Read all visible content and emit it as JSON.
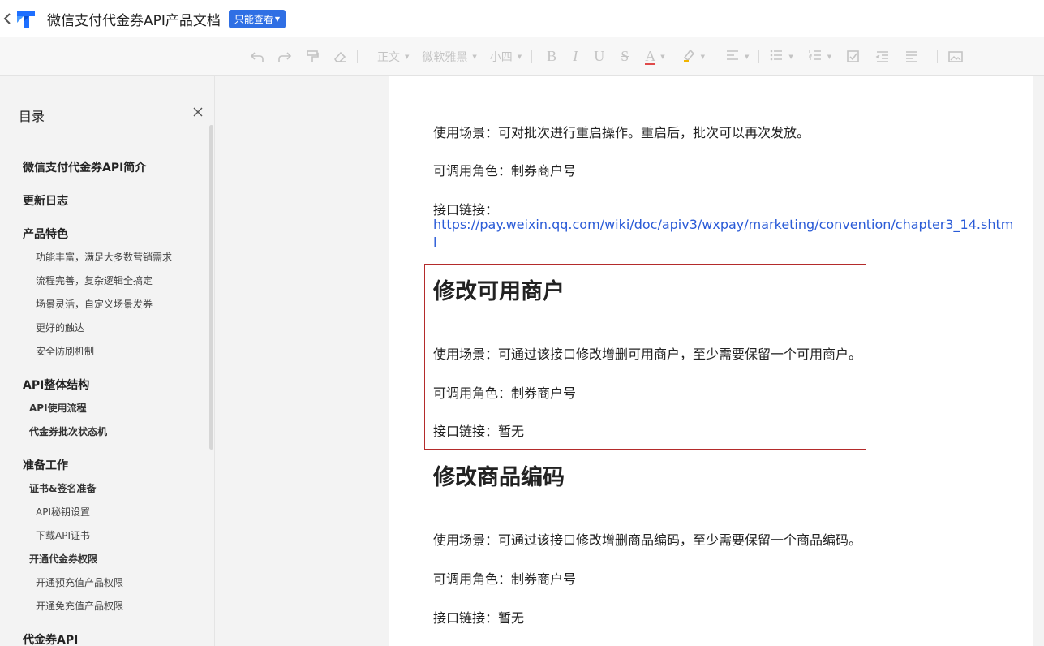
{
  "header": {
    "back_icon": "chevron-left-icon",
    "logo_icon": "tencent-docs-logo-icon",
    "title": "微信支付代金券API产品文档",
    "mode_badge": "只能查看"
  },
  "toolbar": {
    "undo_icon": "undo-icon",
    "redo_icon": "redo-icon",
    "format_painter_icon": "format-painter-icon",
    "clear_format_icon": "eraser-icon",
    "paragraph_style": "正文",
    "font_family": "微软雅黑",
    "font_size": "小四",
    "bold": "B",
    "italic": "I",
    "underline": "U",
    "strikethrough": "S",
    "font_color": "A",
    "highlight_icon": "highlighter-icon",
    "align_icon": "align-icon",
    "bullet_list_icon": "bullet-list-icon",
    "numbered_list_icon": "numbered-list-icon",
    "checklist_icon": "checklist-icon",
    "indent_icon": "indent-icon",
    "outdent_icon": "outdent-icon",
    "image_icon": "image-icon"
  },
  "sidebar": {
    "title": "目录",
    "close_icon": "close-icon",
    "items": [
      {
        "label": "微信支付代金券API简介",
        "level": 1
      },
      {
        "label": "更新日志",
        "level": 1
      },
      {
        "label": "产品特色",
        "level": 1
      },
      {
        "label": "功能丰富，满足大多数营销需求",
        "level": 3
      },
      {
        "label": "流程完善，复杂逻辑全搞定",
        "level": 3
      },
      {
        "label": "场景灵活，自定义场景发券",
        "level": 3
      },
      {
        "label": "更好的触达",
        "level": 3
      },
      {
        "label": "安全防刷机制",
        "level": 3
      },
      {
        "label": "API整体结构",
        "level": 1
      },
      {
        "label": "API使用流程",
        "level": 2
      },
      {
        "label": "代金券批次状态机",
        "level": 2
      },
      {
        "label": "准备工作",
        "level": 1
      },
      {
        "label": "证书&签名准备",
        "level": 2
      },
      {
        "label": "API秘钥设置",
        "level": 3
      },
      {
        "label": "下载API证书",
        "level": 3
      },
      {
        "label": "开通代金券权限",
        "level": 2
      },
      {
        "label": "开通预充值产品权限",
        "level": 3
      },
      {
        "label": "开通免充值产品权限",
        "level": 3
      },
      {
        "label": "代金券API",
        "level": 1
      }
    ]
  },
  "document": {
    "restart": {
      "scene": "使用场景：可对批次进行重启操作。重启后，批次可以再次发放。",
      "role": "可调用角色：制券商户号",
      "link_label": "接口链接：",
      "link_line1": "https://pay.weixin.qq.com/wiki/doc/apiv3/wxpay/marketing/convention/chapter3_14.shtm",
      "link_line2": "l"
    },
    "modify_merchant": {
      "heading": "修改可用商户",
      "scene": "使用场景：可通过该接口修改增删可用商户，至少需要保留一个可用商户。",
      "role": "可调用角色：制券商户号",
      "link": "接口链接：暂无"
    },
    "modify_goods": {
      "heading": "修改商品编码",
      "scene": "使用场景：可通过该接口修改增删商品编码，至少需要保留一个商品编码。",
      "role": "可调用角色：制券商户号",
      "link": "接口链接：暂无"
    }
  },
  "colors": {
    "badge": "#2f6fe4",
    "link": "#2a5bd7",
    "highlight_border": "#b42b2b",
    "font_color_underline": "#e04a4a",
    "highlighter": "#f0b400"
  }
}
